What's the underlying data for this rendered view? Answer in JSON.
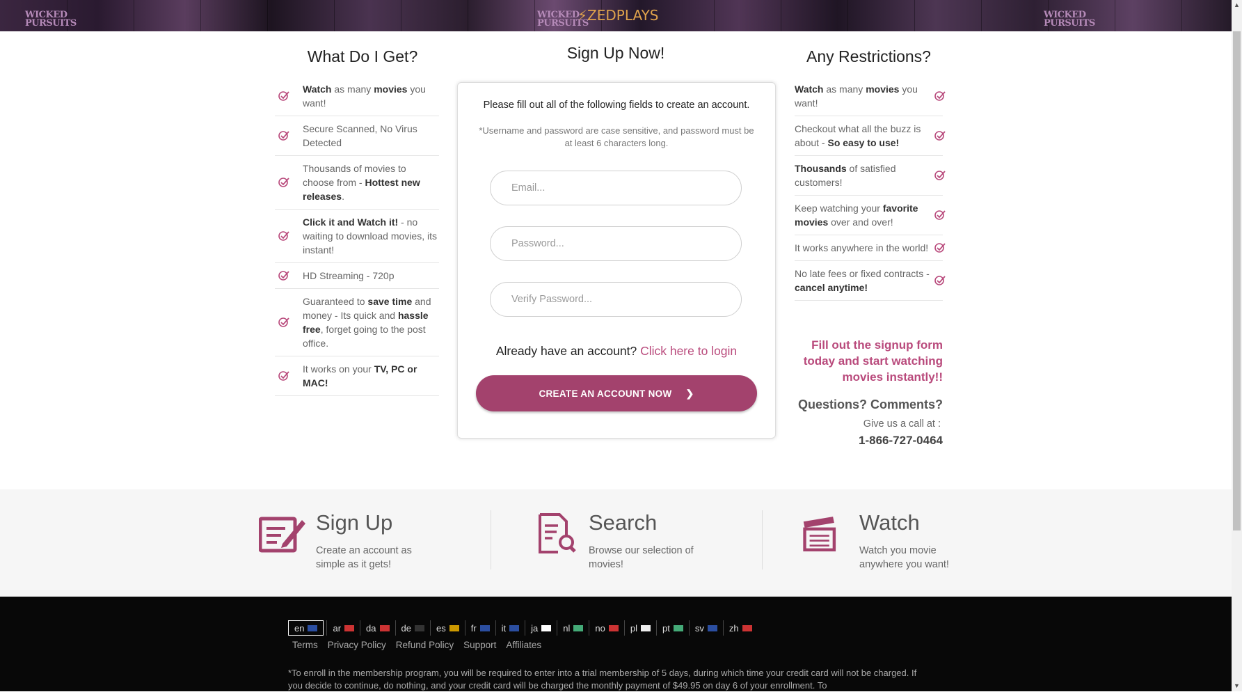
{
  "banner": {
    "logo_text": "ZEDPLAYS",
    "logo_bolt": "⚡",
    "poster_tags": [
      "WICKED PURSUITS",
      "WICKED PURSUITS",
      "WICKED PURSUITS"
    ]
  },
  "left_column": {
    "title": "What Do I Get?",
    "features": [
      {
        "parts": [
          [
            "b",
            "Watch"
          ],
          [
            "t",
            " as many "
          ],
          [
            "b",
            "movies"
          ],
          [
            "t",
            " you want!"
          ]
        ]
      },
      {
        "parts": [
          [
            "t",
            "Secure Scanned, No Virus Detected"
          ]
        ]
      },
      {
        "parts": [
          [
            "t",
            "Thousands of movies to choose from - "
          ],
          [
            "b",
            "Hottest new releases"
          ],
          [
            "t",
            "."
          ]
        ]
      },
      {
        "parts": [
          [
            "b",
            "Click it and Watch it!"
          ],
          [
            "t",
            " - no waiting to download movies, its instant!"
          ]
        ]
      },
      {
        "parts": [
          [
            "t",
            "HD Streaming - 720p"
          ]
        ]
      },
      {
        "parts": [
          [
            "t",
            "Guaranteed to "
          ],
          [
            "b",
            "save time"
          ],
          [
            "t",
            " and money - Its quick and "
          ],
          [
            "b",
            "hassle free"
          ],
          [
            "t",
            ", forget going to the post office."
          ]
        ]
      },
      {
        "parts": [
          [
            "t",
            "It works on your "
          ],
          [
            "b",
            "TV, PC or MAC!"
          ]
        ]
      }
    ]
  },
  "signup": {
    "title": "Sign Up Now!",
    "intro": "Please fill out all of the following fields to create an account.",
    "note": "*Username and password are case sensitive, and password must be at least 6 characters long.",
    "email_placeholder": "Email...",
    "password_placeholder": "Password...",
    "verify_placeholder": "Verify Password...",
    "login_prompt": "Already have an account?",
    "login_link": "Click here to login",
    "cta_label": "CREATE AN ACCOUNT NOW",
    "cta_arrow": "❯"
  },
  "right_column": {
    "title": "Any Restrictions?",
    "features": [
      {
        "parts": [
          [
            "b",
            "Watch"
          ],
          [
            "t",
            " as many "
          ],
          [
            "b",
            "movies"
          ],
          [
            "t",
            " you want!"
          ]
        ]
      },
      {
        "parts": [
          [
            "t",
            "Checkout what all the buzz is about - "
          ],
          [
            "b",
            "So easy to use!"
          ]
        ]
      },
      {
        "parts": [
          [
            "b",
            "Thousands"
          ],
          [
            "t",
            " of satisfied customers!"
          ]
        ]
      },
      {
        "parts": [
          [
            "t",
            "Keep watching your "
          ],
          [
            "b",
            "favorite movies"
          ],
          [
            "t",
            " over and over!"
          ]
        ]
      },
      {
        "parts": [
          [
            "t",
            "It works anywhere in the world!"
          ]
        ]
      },
      {
        "parts": [
          [
            "t",
            "No late fees or fixed contracts - "
          ],
          [
            "b",
            "cancel anytime!"
          ]
        ]
      }
    ],
    "promo": "Fill out the signup form today and start watching movies instantly!!",
    "questions": "Questions? Comments?",
    "call_label": "Give us a call at :",
    "phone": "1-866-727-0464"
  },
  "steps": [
    {
      "title": "Sign Up",
      "desc": "Create an account as simple as it gets!",
      "icon": "signup-form-icon"
    },
    {
      "title": "Search",
      "desc": "Browse our selection of movies!",
      "icon": "search-document-icon"
    },
    {
      "title": "Watch",
      "desc": "Watch you movie anywhere you want!",
      "icon": "clapperboard-icon"
    }
  ],
  "footer": {
    "languages": [
      "en",
      "ar",
      "da",
      "de",
      "es",
      "fr",
      "it",
      "ja",
      "nl",
      "no",
      "pl",
      "pt",
      "sv",
      "zh"
    ],
    "active_language": "en",
    "links": [
      "Terms",
      "Privacy Policy",
      "Refund Policy",
      "Support",
      "Affiliates"
    ],
    "disclaimer": "*To enroll in the membership program, you will be required to enter into a trial membership of 5 days, during which time your credit card will not be charged. If you decide to continue, do nothing, and your credit card will be charged the monthly payment of $49.95 on day 6 of your enrollment. To"
  },
  "colors": {
    "accent": "#a3426d",
    "link": "#b94a7c",
    "footer_bg": "#080808",
    "steps_bg": "#f6f6f6"
  }
}
